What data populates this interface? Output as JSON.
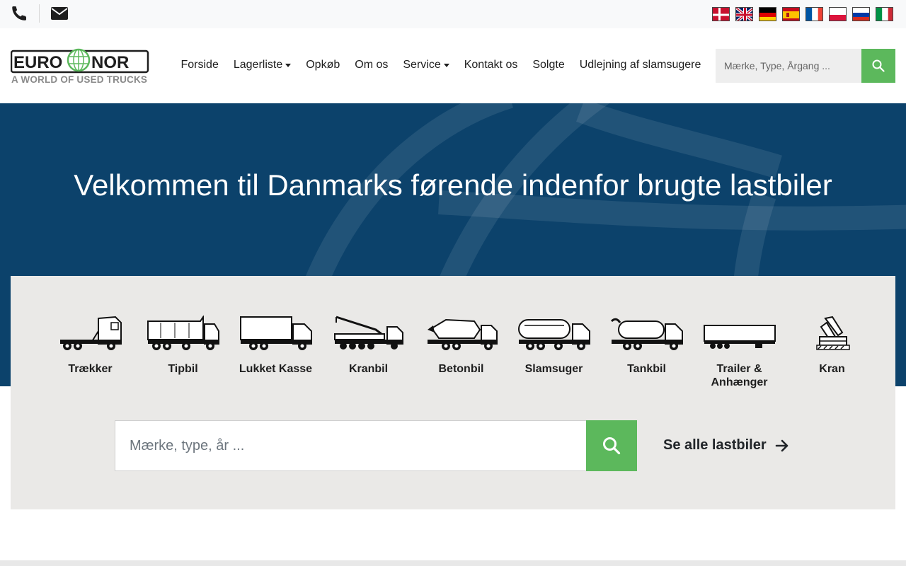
{
  "brand": {
    "name": "EURONOR",
    "tagline": "A WORLD OF USED TRUCKS",
    "colors": {
      "dark": "#1e1e1e",
      "grey": "#8a8a8a",
      "green": "#5cb85c"
    }
  },
  "topbar": {
    "icons": [
      "phone-icon",
      "envelope-icon"
    ],
    "languages": [
      "Dansk",
      "English",
      "Deutsch",
      "Español",
      "Français",
      "Polski",
      "Русский",
      "Italiano"
    ]
  },
  "nav": {
    "items": [
      {
        "label": "Forside",
        "dropdown": false
      },
      {
        "label": "Lagerliste",
        "dropdown": true
      },
      {
        "label": "Opkøb",
        "dropdown": false
      },
      {
        "label": "Om os",
        "dropdown": false
      },
      {
        "label": "Service",
        "dropdown": true
      },
      {
        "label": "Kontakt os",
        "dropdown": false
      },
      {
        "label": "Solgte",
        "dropdown": false
      },
      {
        "label": "Udlejning af slamsugere",
        "dropdown": false
      }
    ],
    "search_placeholder": "Mærke, Type, Årgang ..."
  },
  "hero": {
    "title": "Velkommen til Danmarks førende indenfor brugte lastbiler",
    "background": "#0c426b"
  },
  "categories": [
    {
      "label": "Trækker",
      "icon": "tractor-unit-icon"
    },
    {
      "label": "Tipbil",
      "icon": "tipper-truck-icon"
    },
    {
      "label": "Lukket Kasse",
      "icon": "box-truck-icon"
    },
    {
      "label": "Kranbil",
      "icon": "crane-truck-icon"
    },
    {
      "label": "Betonbil",
      "icon": "concrete-mixer-icon"
    },
    {
      "label": "Slamsuger",
      "icon": "vacuum-truck-icon"
    },
    {
      "label": "Tankbil",
      "icon": "tank-truck-icon"
    },
    {
      "label": "Trailer & Anhænger",
      "icon": "trailer-icon"
    },
    {
      "label": "Kran",
      "icon": "crane-icon"
    }
  ],
  "search": {
    "placeholder": "Mærke, type, år ...",
    "see_all": "Se alle lastbiler"
  }
}
